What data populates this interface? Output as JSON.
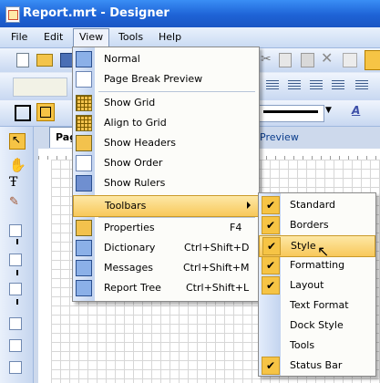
{
  "window": {
    "title": "Report.mrt - Designer"
  },
  "menubar": {
    "items": [
      "File",
      "Edit",
      "View",
      "Tools",
      "Help"
    ]
  },
  "tabs": {
    "page": "Pag",
    "preview": "Preview"
  },
  "view_menu": {
    "items": [
      {
        "label": "Normal",
        "shortcut": ""
      },
      {
        "label": "Page Break Preview",
        "shortcut": ""
      },
      {
        "label": "Show Grid",
        "shortcut": ""
      },
      {
        "label": "Align to Grid",
        "shortcut": ""
      },
      {
        "label": "Show Headers",
        "shortcut": ""
      },
      {
        "label": "Show Order",
        "shortcut": ""
      },
      {
        "label": "Show Rulers",
        "shortcut": ""
      },
      {
        "label": "Toolbars",
        "shortcut": ""
      },
      {
        "label": "Properties",
        "shortcut": "F4"
      },
      {
        "label": "Dictionary",
        "shortcut": "Ctrl+Shift+D"
      },
      {
        "label": "Messages",
        "shortcut": "Ctrl+Shift+M"
      },
      {
        "label": "Report Tree",
        "shortcut": "Ctrl+Shift+L"
      }
    ]
  },
  "toolbars_submenu": {
    "items": [
      {
        "label": "Standard",
        "checked": true
      },
      {
        "label": "Borders",
        "checked": true
      },
      {
        "label": "Style",
        "checked": true
      },
      {
        "label": "Formatting",
        "checked": true
      },
      {
        "label": "Layout",
        "checked": true
      },
      {
        "label": "Text Format",
        "checked": false
      },
      {
        "label": "Dock Style",
        "checked": false
      },
      {
        "label": "Tools",
        "checked": false
      },
      {
        "label": "Status Bar",
        "checked": true
      }
    ]
  },
  "toolbar": {
    "font_color_glyph": "A"
  },
  "colors": {
    "highlight": "#f8c85a",
    "title_bar": "#1e63d6",
    "gutter": "#c3d4ef"
  }
}
